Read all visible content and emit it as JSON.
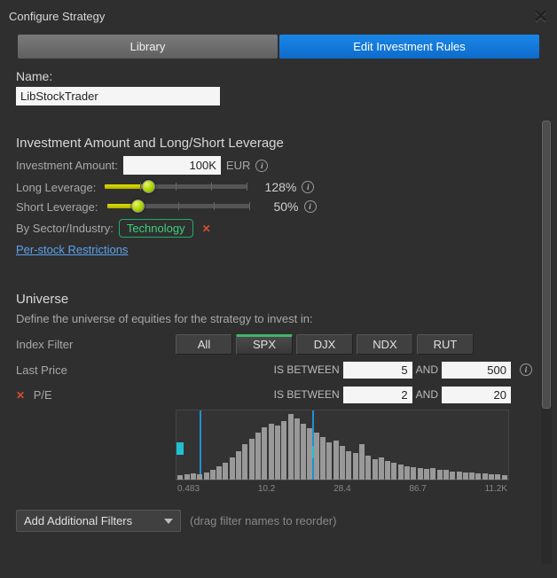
{
  "titlebar": {
    "title": "Configure Strategy"
  },
  "tabs": {
    "library": "Library",
    "rules": "Edit Investment Rules"
  },
  "name": {
    "label": "Name:",
    "value": "LibStockTrader"
  },
  "investment": {
    "section_title": "Investment Amount and Long/Short Leverage",
    "amount_label": "Investment Amount:",
    "amount_value": "100K",
    "currency": "EUR",
    "long_label": "Long Leverage:",
    "long_pct": "128%",
    "short_label": "Short Leverage:",
    "short_pct": "50%",
    "sector_label": "By Sector/Industry:",
    "sector_value": "Technology",
    "restrictions_link": "Per-stock Restrictions"
  },
  "universe": {
    "title": "Universe",
    "subtitle": "Define the universe of equities for the strategy to invest in:",
    "index_filter_label": "Index Filter",
    "index_options": {
      "all": "All",
      "spx": "SPX",
      "djx": "DJX",
      "ndx": "NDX",
      "rut": "RUT"
    },
    "last_price_label": "Last Price",
    "pe_label": "P/E",
    "op_between": "IS BETWEEN",
    "op_and": "AND",
    "last_price_lo": "5",
    "last_price_hi": "500",
    "pe_lo": "2",
    "pe_hi": "20",
    "axis": {
      "t0": "0.483",
      "t1": "10.2",
      "t2": "28.4",
      "t3": "86.7",
      "t4": "11.2K"
    },
    "add_filters_label": "Add Additional Filters",
    "drag_hint": "(drag filter names to reorder)"
  },
  "chart_data": {
    "type": "bar",
    "title": "",
    "xlabel": "",
    "ylabel": "",
    "categories_note": "x-axis nonlinear; tick labels shown",
    "x_ticks": [
      "0.483",
      "10.2",
      "28.4",
      "86.7",
      "11.2K"
    ],
    "values": [
      5,
      6,
      7,
      6,
      8,
      10,
      14,
      18,
      24,
      30,
      38,
      44,
      50,
      56,
      60,
      58,
      62,
      70,
      65,
      60,
      55,
      50,
      45,
      40,
      42,
      36,
      30,
      28,
      38,
      26,
      22,
      24,
      20,
      18,
      16,
      14,
      13,
      12,
      11,
      12,
      10,
      10,
      9,
      9,
      8,
      8,
      7,
      7,
      6,
      6,
      5
    ],
    "markers": {
      "low": 5,
      "high": 22
    }
  }
}
